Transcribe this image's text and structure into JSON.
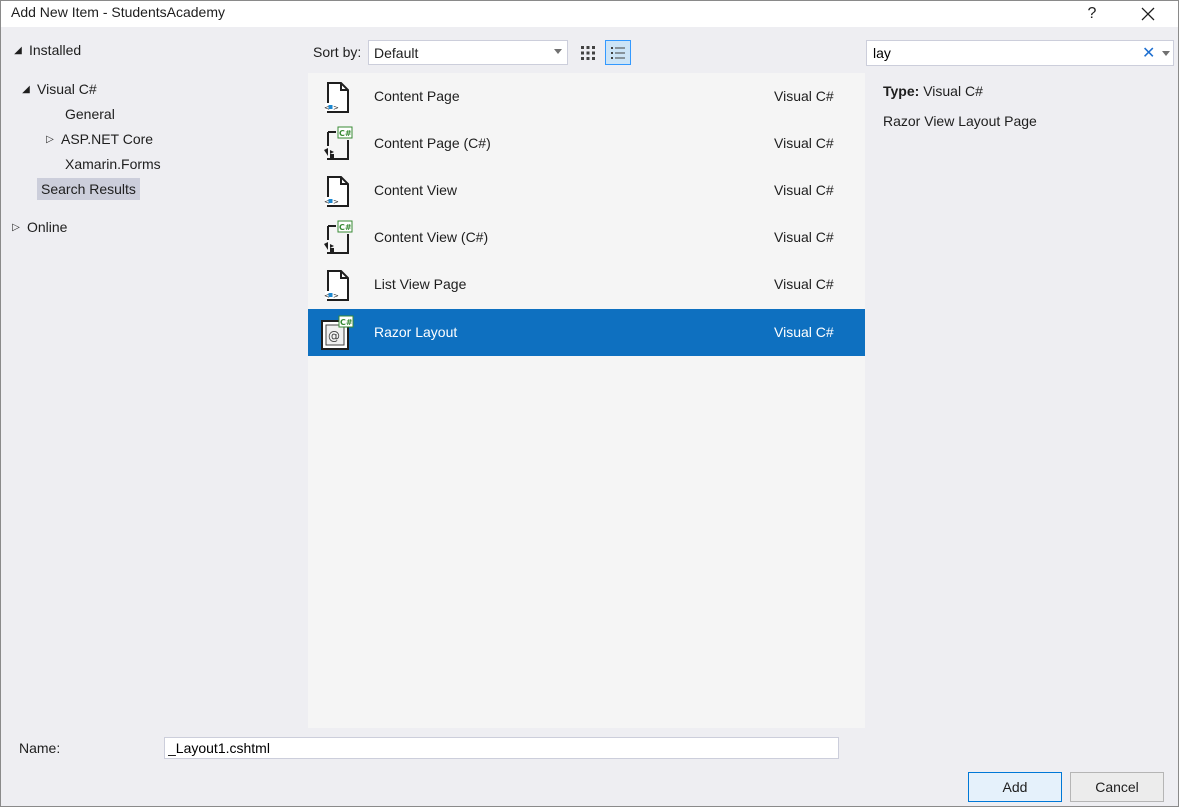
{
  "window": {
    "title": "Add New Item - StudentsAcademy",
    "help_label": "?",
    "close_label": "✕"
  },
  "tree": {
    "installed": "Installed",
    "visual_csharp": "Visual C#",
    "general": "General",
    "aspnet_core": "ASP.NET Core",
    "xamarin_forms": "Xamarin.Forms",
    "search_results": "Search Results",
    "online": "Online"
  },
  "sort": {
    "label": "Sort by:",
    "value": "Default"
  },
  "search": {
    "value": "lay",
    "clear_label": "✕"
  },
  "templates": [
    {
      "name": "Content Page",
      "type": "Visual C#",
      "icon": "xaml-page-icon"
    },
    {
      "name": "Content Page (C#)",
      "type": "Visual C#",
      "icon": "csharp-page-icon"
    },
    {
      "name": "Content View",
      "type": "Visual C#",
      "icon": "xaml-page-icon"
    },
    {
      "name": "Content View (C#)",
      "type": "Visual C#",
      "icon": "csharp-page-icon"
    },
    {
      "name": "List View Page",
      "type": "Visual C#",
      "icon": "xaml-page-icon"
    },
    {
      "name": "Razor Layout",
      "type": "Visual C#",
      "icon": "razor-icon",
      "selected": true
    }
  ],
  "details": {
    "type_label": "Type:",
    "type_value": "Visual C#",
    "description": "Razor View Layout Page"
  },
  "footer": {
    "name_label": "Name:",
    "name_value": "_Layout1.cshtml",
    "add_label": "Add",
    "cancel_label": "Cancel"
  },
  "colors": {
    "selection": "#0e70c0",
    "accent_green": "#388a34",
    "window_bg": "#eeeef2"
  }
}
